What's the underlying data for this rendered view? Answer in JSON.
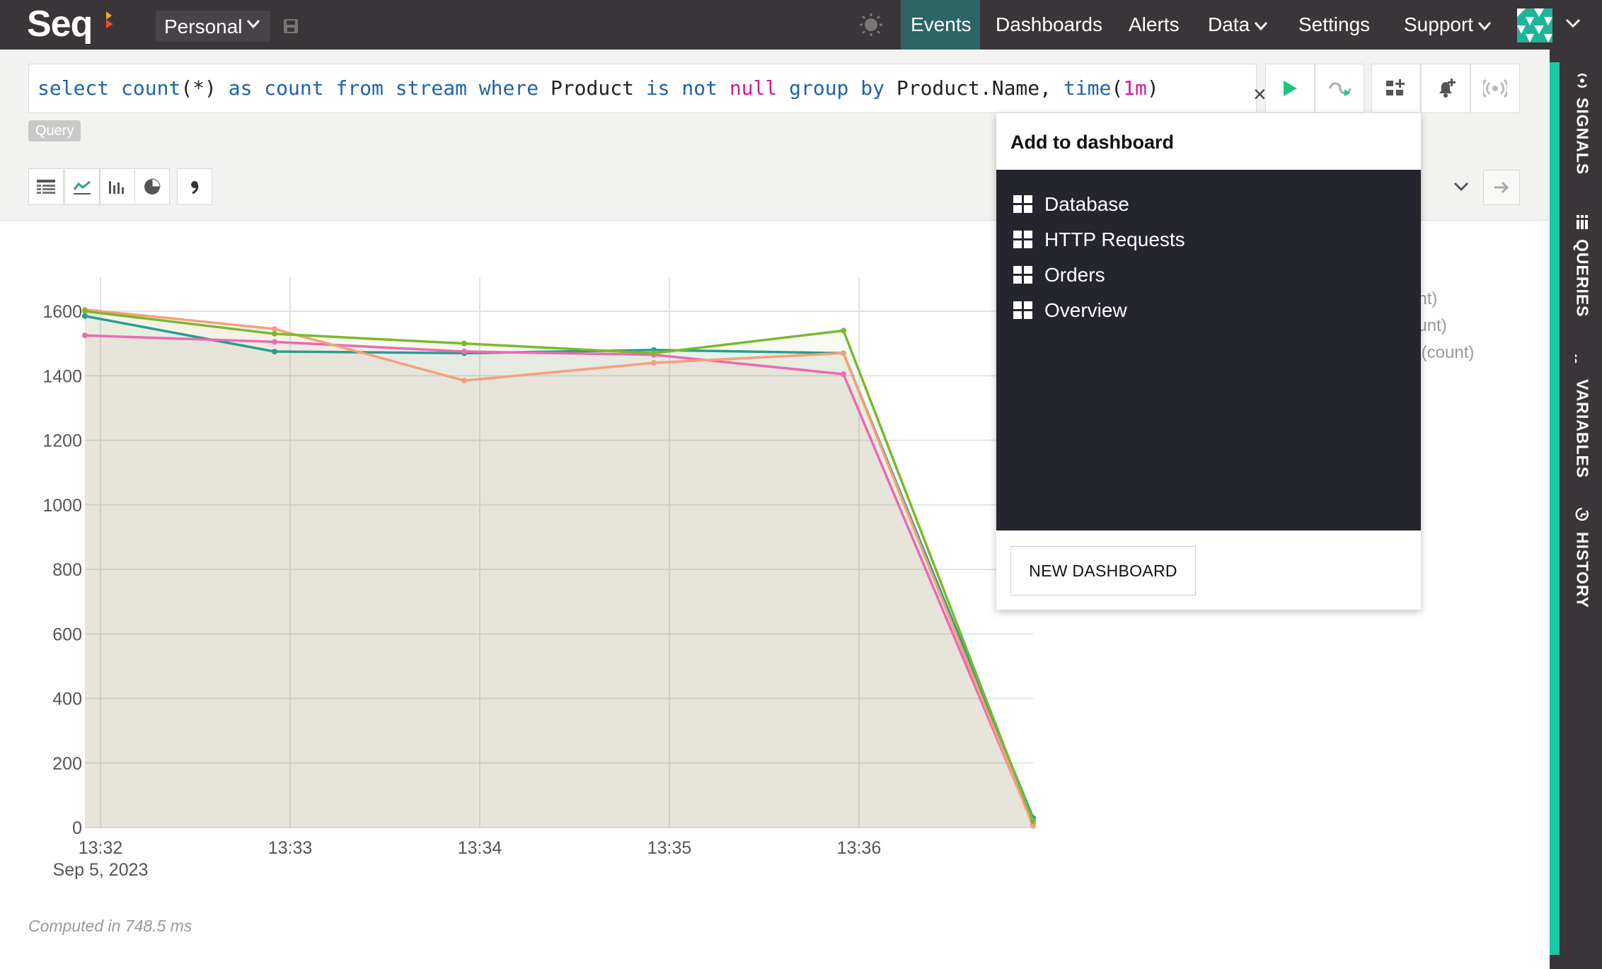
{
  "app": {
    "logo": "Seq"
  },
  "header": {
    "workspace": "Personal",
    "nav": [
      {
        "label": "Events",
        "active": true
      },
      {
        "label": "Dashboards"
      },
      {
        "label": "Alerts"
      },
      {
        "label": "Data",
        "dropdown": true
      },
      {
        "label": "Settings"
      },
      {
        "label": "Support",
        "dropdown": true
      }
    ]
  },
  "query": {
    "tokens": [
      {
        "t": "select",
        "c": "kw"
      },
      {
        "t": " ",
        "c": "id"
      },
      {
        "t": "count",
        "c": "kw"
      },
      {
        "t": "(*) ",
        "c": "id"
      },
      {
        "t": "as",
        "c": "kw"
      },
      {
        "t": " ",
        "c": "id"
      },
      {
        "t": "count",
        "c": "kw"
      },
      {
        "t": " ",
        "c": "id"
      },
      {
        "t": "from",
        "c": "kw"
      },
      {
        "t": " ",
        "c": "id"
      },
      {
        "t": "stream",
        "c": "kw"
      },
      {
        "t": " ",
        "c": "id"
      },
      {
        "t": "where",
        "c": "kw"
      },
      {
        "t": " Product ",
        "c": "id"
      },
      {
        "t": "is",
        "c": "kw"
      },
      {
        "t": " ",
        "c": "id"
      },
      {
        "t": "not",
        "c": "kw"
      },
      {
        "t": " ",
        "c": "id"
      },
      {
        "t": "null",
        "c": "nm"
      },
      {
        "t": " ",
        "c": "id"
      },
      {
        "t": "group",
        "c": "kw"
      },
      {
        "t": " ",
        "c": "id"
      },
      {
        "t": "by",
        "c": "kw"
      },
      {
        "t": " Product.Name, ",
        "c": "id"
      },
      {
        "t": "time",
        "c": "kw"
      },
      {
        "t": "(",
        "c": "id"
      },
      {
        "t": "1m",
        "c": "nm"
      },
      {
        "t": ")",
        "c": "id"
      }
    ],
    "clear_label": "×",
    "badge": "Query"
  },
  "dashboard_menu": {
    "title": "Add to dashboard",
    "items": [
      {
        "label": "Database"
      },
      {
        "label": "HTTP Requests"
      },
      {
        "label": "Orders"
      },
      {
        "label": "Overview"
      }
    ],
    "new_button": "NEW DASHBOARD"
  },
  "legend": {
    "items": [
      "unt)",
      "ount)",
      "s (count)"
    ]
  },
  "sidebar": {
    "tabs": [
      {
        "label": "SIGNALS"
      },
      {
        "label": "QUERIES"
      },
      {
        "label": "VARIABLES"
      },
      {
        "label": "HISTORY"
      }
    ]
  },
  "status": {
    "computed": "Computed in 748.5 ms"
  },
  "chart_data": {
    "type": "line",
    "x": [
      "13:32",
      "13:33",
      "13:34",
      "13:35",
      "13:36",
      "13:37"
    ],
    "x_tick_labels": [
      "13:32",
      "13:33",
      "13:34",
      "13:35",
      "13:36"
    ],
    "x_date_label": "Sep 5, 2023",
    "y_ticks": [
      0,
      200,
      400,
      600,
      800,
      1000,
      1200,
      1400,
      1600
    ],
    "ylim": [
      0,
      1600
    ],
    "grid": true,
    "series": [
      {
        "color": "#2a9d8f",
        "values": [
          1585,
          1475,
          1470,
          1480,
          1470,
          30
        ]
      },
      {
        "color": "#e96bb3",
        "values": [
          1525,
          1505,
          1475,
          1465,
          1405,
          10
        ]
      },
      {
        "color": "#f4a07c",
        "values": [
          1605,
          1545,
          1385,
          1440,
          1470,
          5
        ]
      },
      {
        "color": "#7cb82f",
        "values": [
          1600,
          1530,
          1500,
          1470,
          1540,
          20
        ]
      }
    ]
  }
}
